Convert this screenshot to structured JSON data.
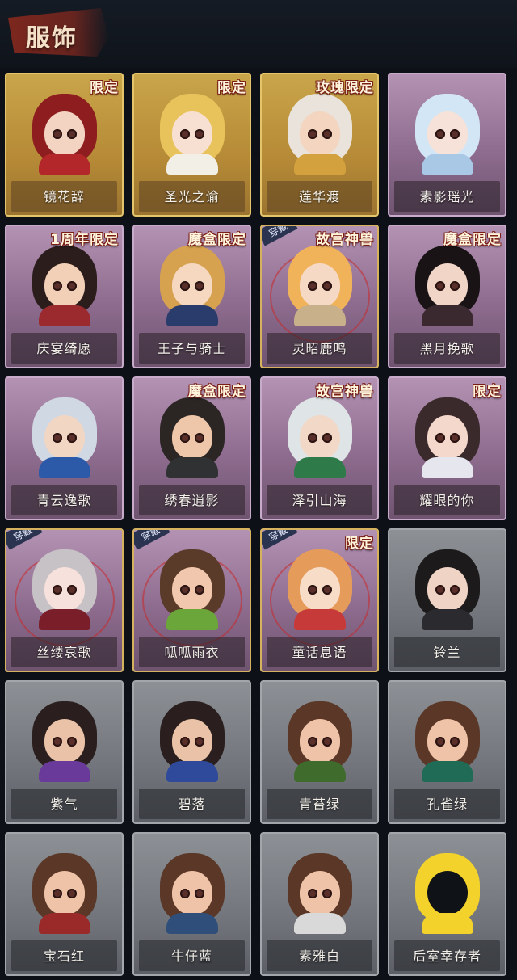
{
  "header": {
    "title": "服饰"
  },
  "cards": [
    {
      "name": "镜花辞",
      "badge": "限定",
      "frame": "gold",
      "worn": false,
      "worn_label": "",
      "colors": {
        "hair": "#8d1d1f",
        "face": "#f3d4c2",
        "outfit": "#b3262a"
      },
      "icon": "portrait-icon"
    },
    {
      "name": "圣光之谕",
      "badge": "限定",
      "frame": "gold",
      "worn": false,
      "worn_label": "",
      "colors": {
        "hair": "#e8c35b",
        "face": "#f7e0d2",
        "outfit": "#f2efe7"
      },
      "icon": "portrait-icon"
    },
    {
      "name": "莲华渡",
      "badge": "玫瑰限定",
      "frame": "gold",
      "worn": false,
      "worn_label": "",
      "colors": {
        "hair": "#e9e3db",
        "face": "#f4d5bf",
        "outfit": "#d3a23e"
      },
      "icon": "portrait-icon"
    },
    {
      "name": "素影瑶光",
      "badge": "",
      "frame": "purple",
      "worn": false,
      "worn_label": "",
      "colors": {
        "hair": "#d3e6f5",
        "face": "#f6e2d8",
        "outfit": "#a9c8e6"
      },
      "icon": "portrait-icon"
    },
    {
      "name": "庆宴绮愿",
      "badge": "1周年限定",
      "frame": "purple",
      "worn": false,
      "worn_label": "",
      "colors": {
        "hair": "#2b1d1b",
        "face": "#f2d0b8",
        "outfit": "#9b2a2f"
      },
      "icon": "portrait-icon"
    },
    {
      "name": "王子与骑士",
      "badge": "魔盒限定",
      "frame": "purple",
      "worn": false,
      "worn_label": "",
      "colors": {
        "hair": "#d6a24f",
        "face": "#f6d7c0",
        "outfit": "#2a3c6b"
      },
      "icon": "portrait-icon"
    },
    {
      "name": "灵昭鹿鸣",
      "badge": "故宫神兽",
      "frame": "purple",
      "worn": true,
      "worn_label": "穿戴",
      "colors": {
        "hair": "#f0b35a",
        "face": "#f6d9c5",
        "outfit": "#c8b08a"
      },
      "icon": "portrait-icon"
    },
    {
      "name": "黑月挽歌",
      "badge": "魔盒限定",
      "frame": "purple",
      "worn": false,
      "worn_label": "",
      "colors": {
        "hair": "#1a1316",
        "face": "#f1d6c8",
        "outfit": "#3a2a2f"
      },
      "icon": "portrait-icon"
    },
    {
      "name": "青云逸歌",
      "badge": "",
      "frame": "purple",
      "worn": false,
      "worn_label": "",
      "colors": {
        "hair": "#cfd8e3",
        "face": "#f2d6c4",
        "outfit": "#2c5aa8"
      },
      "icon": "portrait-icon"
    },
    {
      "name": "绣春逍影",
      "badge": "魔盒限定",
      "frame": "purple",
      "worn": false,
      "worn_label": "",
      "colors": {
        "hair": "#2b2523",
        "face": "#eec7ab",
        "outfit": "#2f3133"
      },
      "icon": "portrait-icon"
    },
    {
      "name": "泽引山海",
      "badge": "故宫神兽",
      "frame": "purple",
      "worn": false,
      "worn_label": "",
      "colors": {
        "hair": "#dfe5e6",
        "face": "#f2d8c7",
        "outfit": "#2e7a48"
      },
      "icon": "portrait-icon"
    },
    {
      "name": "耀眼的你",
      "badge": "限定",
      "frame": "purple",
      "worn": false,
      "worn_label": "",
      "colors": {
        "hair": "#3b2a2c",
        "face": "#f5d8cc",
        "outfit": "#e6e6ee"
      },
      "icon": "portrait-icon"
    },
    {
      "name": "丝缕哀歌",
      "badge": "",
      "frame": "purple",
      "worn": true,
      "worn_label": "穿戴",
      "colors": {
        "hair": "#c7c2c5",
        "face": "#f6e1dc",
        "outfit": "#7a1f2a"
      },
      "icon": "portrait-icon"
    },
    {
      "name": "呱呱雨衣",
      "badge": "",
      "frame": "purple",
      "worn": true,
      "worn_label": "穿戴",
      "colors": {
        "hair": "#5a3a28",
        "face": "#f1c7ad",
        "outfit": "#6aa63a"
      },
      "icon": "portrait-icon"
    },
    {
      "name": "童话息语",
      "badge": "限定",
      "frame": "purple",
      "worn": true,
      "worn_label": "穿戴",
      "colors": {
        "hair": "#e59b5a",
        "face": "#f7dcc8",
        "outfit": "#c73a3a"
      },
      "icon": "portrait-icon"
    },
    {
      "name": "铃兰",
      "badge": "",
      "frame": "gray",
      "worn": false,
      "worn_label": "",
      "colors": {
        "hair": "#1c1a1a",
        "face": "#efd3c5",
        "outfit": "#2a2a2f"
      },
      "icon": "portrait-icon"
    },
    {
      "name": "紫气",
      "badge": "",
      "frame": "gray",
      "worn": false,
      "worn_label": "",
      "colors": {
        "hair": "#2a1f1e",
        "face": "#e9c2a8",
        "outfit": "#6a3a9a"
      },
      "icon": "portrait-icon"
    },
    {
      "name": "碧落",
      "badge": "",
      "frame": "gray",
      "worn": false,
      "worn_label": "",
      "colors": {
        "hair": "#2a1f1e",
        "face": "#e9c2a8",
        "outfit": "#2f4a9a"
      },
      "icon": "portrait-icon"
    },
    {
      "name": "青苔绿",
      "badge": "",
      "frame": "gray",
      "worn": false,
      "worn_label": "",
      "colors": {
        "hair": "#5a3727",
        "face": "#efc3a8",
        "outfit": "#3f6b2d"
      },
      "icon": "portrait-icon"
    },
    {
      "name": "孔雀绿",
      "badge": "",
      "frame": "gray",
      "worn": false,
      "worn_label": "",
      "colors": {
        "hair": "#5a3727",
        "face": "#efc3a8",
        "outfit": "#1f6b55"
      },
      "icon": "portrait-icon"
    },
    {
      "name": "宝石红",
      "badge": "",
      "frame": "gray",
      "worn": false,
      "worn_label": "",
      "colors": {
        "hair": "#5a3727",
        "face": "#efc3a8",
        "outfit": "#9a2a2a"
      },
      "icon": "portrait-icon"
    },
    {
      "name": "牛仔蓝",
      "badge": "",
      "frame": "gray",
      "worn": false,
      "worn_label": "",
      "colors": {
        "hair": "#5a3727",
        "face": "#efc3a8",
        "outfit": "#2f4f7a"
      },
      "icon": "portrait-icon"
    },
    {
      "name": "素雅白",
      "badge": "",
      "frame": "gray",
      "worn": false,
      "worn_label": "",
      "colors": {
        "hair": "#5a3727",
        "face": "#efc3a8",
        "outfit": "#d9d9d9"
      },
      "icon": "portrait-icon"
    },
    {
      "name": "后室幸存者",
      "badge": "",
      "frame": "gray",
      "worn": false,
      "worn_label": "",
      "colors": {
        "hair": "#f2d22b",
        "face": "#101217",
        "outfit": "#f2d22b"
      },
      "icon": "gas-mask-icon"
    }
  ]
}
